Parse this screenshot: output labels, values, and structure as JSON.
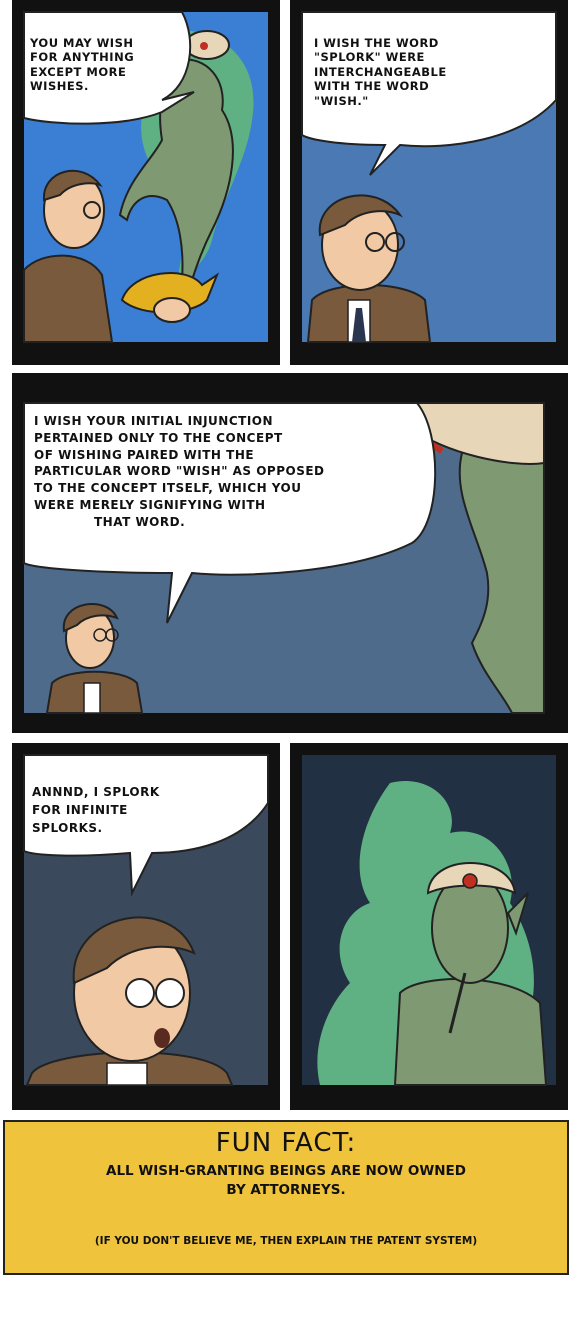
{
  "panels": [
    {
      "id": 1,
      "speech": [
        "YOU MAY WISH",
        "FOR ANYTHING",
        "EXCEPT MORE",
        "WISHES."
      ]
    },
    {
      "id": 2,
      "speech": [
        "I WISH THE WORD",
        "\"SPLORK\" WERE",
        "INTERCHANGEABLE",
        "WITH THE WORD",
        "\"WISH.\""
      ]
    },
    {
      "id": 3,
      "speech": [
        "I WISH YOUR INITIAL INJUNCTION",
        "PERTAINED ONLY TO THE CONCEPT",
        "OF WISHING PAIRED WITH THE",
        "PARTICULAR WORD \"WISH\" AS OPPOSED",
        "TO THE CONCEPT ITSELF, WHICH YOU",
        "WERE MERELY SIGNIFYING WITH",
        "THAT WORD."
      ]
    },
    {
      "id": 4,
      "speech": [
        "ANNND, I SPLORK",
        "FOR INFINITE",
        "SPLORKS."
      ]
    },
    {
      "id": 5,
      "speech": []
    }
  ],
  "fun_fact": {
    "title": "FUN FACT:",
    "line1": "ALL WISH-GRANTING BEINGS ARE NOW OWNED",
    "line2": "BY ATTORNEYS.",
    "aside": "(IF YOU DON'T BELIEVE ME, THEN EXPLAIN THE PATENT SYSTEM)"
  },
  "colors": {
    "sky_blue": "#3b7fd4",
    "steel_blue": "#4a79b4",
    "slate": "#4e6b8c",
    "dark_slate": "#3a4a5c",
    "genie_green": "#7f9a72",
    "smoke_green": "#5fb082",
    "suit_brown": "#7a5a3c",
    "skin": "#f1c9a5",
    "fact_yellow": "#f0c33c"
  }
}
